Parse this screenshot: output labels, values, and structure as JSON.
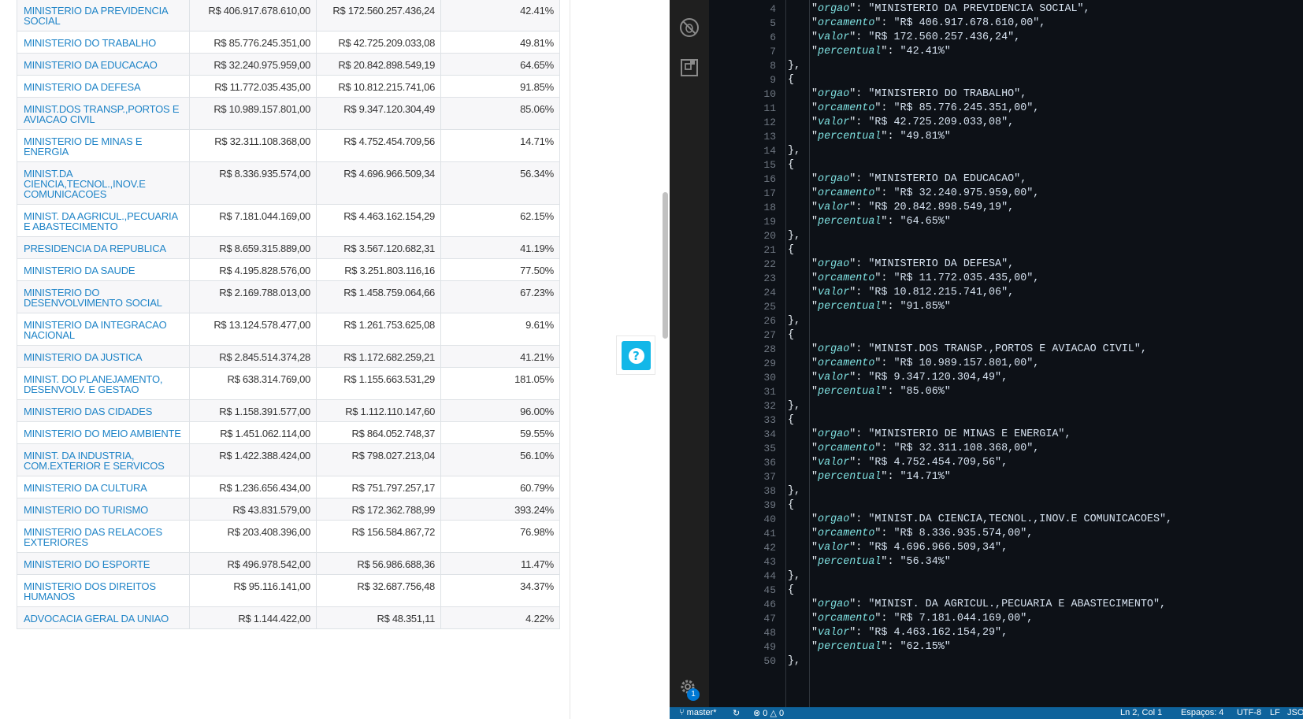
{
  "table": {
    "rows": [
      {
        "orgao": "MINISTERIO DA PREVIDENCIA SOCIAL",
        "orcamento": "R$ 406.917.678.610,00",
        "valor": "R$ 172.560.257.436,24",
        "percentual": "42.41%"
      },
      {
        "orgao": "MINISTERIO DO TRABALHO",
        "orcamento": "R$ 85.776.245.351,00",
        "valor": "R$ 42.725.209.033,08",
        "percentual": "49.81%"
      },
      {
        "orgao": "MINISTERIO DA EDUCACAO",
        "orcamento": "R$ 32.240.975.959,00",
        "valor": "R$ 20.842.898.549,19",
        "percentual": "64.65%"
      },
      {
        "orgao": "MINISTERIO DA DEFESA",
        "orcamento": "R$ 11.772.035.435,00",
        "valor": "R$ 10.812.215.741,06",
        "percentual": "91.85%"
      },
      {
        "orgao": "MINIST.DOS TRANSP.,PORTOS E AVIACAO CIVIL",
        "orcamento": "R$ 10.989.157.801,00",
        "valor": "R$ 9.347.120.304,49",
        "percentual": "85.06%"
      },
      {
        "orgao": "MINISTERIO DE MINAS E ENERGIA",
        "orcamento": "R$ 32.311.108.368,00",
        "valor": "R$ 4.752.454.709,56",
        "percentual": "14.71%"
      },
      {
        "orgao": "MINIST.DA CIENCIA,TECNOL.,INOV.E COMUNICACOES",
        "orcamento": "R$ 8.336.935.574,00",
        "valor": "R$ 4.696.966.509,34",
        "percentual": "56.34%"
      },
      {
        "orgao": "MINIST. DA AGRICUL.,PECUARIA E ABASTECIMENTO",
        "orcamento": "R$ 7.181.044.169,00",
        "valor": "R$ 4.463.162.154,29",
        "percentual": "62.15%"
      },
      {
        "orgao": "PRESIDENCIA DA REPUBLICA",
        "orcamento": "R$ 8.659.315.889,00",
        "valor": "R$ 3.567.120.682,31",
        "percentual": "41.19%"
      },
      {
        "orgao": "MINISTERIO DA SAUDE",
        "orcamento": "R$ 4.195.828.576,00",
        "valor": "R$ 3.251.803.116,16",
        "percentual": "77.50%"
      },
      {
        "orgao": "MINISTERIO DO DESENVOLVIMENTO SOCIAL",
        "orcamento": "R$ 2.169.788.013,00",
        "valor": "R$ 1.458.759.064,66",
        "percentual": "67.23%"
      },
      {
        "orgao": "MINISTERIO DA INTEGRACAO NACIONAL",
        "orcamento": "R$ 13.124.578.477,00",
        "valor": "R$ 1.261.753.625,08",
        "percentual": "9.61%"
      },
      {
        "orgao": "MINISTERIO DA JUSTICA",
        "orcamento": "R$ 2.845.514.374,28",
        "valor": "R$ 1.172.682.259,21",
        "percentual": "41.21%"
      },
      {
        "orgao": "MINIST. DO PLANEJAMENTO, DESENVOLV. E GESTAO",
        "orcamento": "R$ 638.314.769,00",
        "valor": "R$ 1.155.663.531,29",
        "percentual": "181.05%"
      },
      {
        "orgao": "MINISTERIO DAS CIDADES",
        "orcamento": "R$ 1.158.391.577,00",
        "valor": "R$ 1.112.110.147,60",
        "percentual": "96.00%"
      },
      {
        "orgao": "MINISTERIO DO MEIO AMBIENTE",
        "orcamento": "R$ 1.451.062.114,00",
        "valor": "R$ 864.052.748,37",
        "percentual": "59.55%"
      },
      {
        "orgao": "MINIST. DA INDUSTRIA, COM.EXTERIOR E SERVICOS",
        "orcamento": "R$ 1.422.388.424,00",
        "valor": "R$ 798.027.213,04",
        "percentual": "56.10%"
      },
      {
        "orgao": "MINISTERIO DA CULTURA",
        "orcamento": "R$ 1.236.656.434,00",
        "valor": "R$ 751.797.257,17",
        "percentual": "60.79%"
      },
      {
        "orgao": "MINISTERIO DO TURISMO",
        "orcamento": "R$ 43.831.579,00",
        "valor": "R$ 172.362.788,99",
        "percentual": "393.24%"
      },
      {
        "orgao": "MINISTERIO DAS RELACOES EXTERIORES",
        "orcamento": "R$ 203.408.396,00",
        "valor": "R$ 156.584.867,72",
        "percentual": "76.98%"
      },
      {
        "orgao": "MINISTERIO DO ESPORTE",
        "orcamento": "R$ 496.978.542,00",
        "valor": "R$ 56.986.688,36",
        "percentual": "11.47%"
      },
      {
        "orgao": "MINISTERIO DOS DIREITOS HUMANOS",
        "orcamento": "R$ 95.116.141,00",
        "valor": "R$ 32.687.756,48",
        "percentual": "34.37%"
      },
      {
        "orgao": "ADVOCACIA GERAL DA UNIAO",
        "orcamento": "R$ 1.144.422,00",
        "valor": "R$ 48.351,11",
        "percentual": "4.22%"
      }
    ]
  },
  "help_button": {
    "label": "?"
  },
  "editor": {
    "json_keys": {
      "orgao": "orgao",
      "orcamento": "orcamento",
      "valor": "valor",
      "percentual": "percentual"
    },
    "lines": [
      {
        "n": "4",
        "type": "kv",
        "key": "orgao",
        "val": "\"MINISTERIO DA PREVIDENCIA SOCIAL\","
      },
      {
        "n": "5",
        "type": "kv",
        "key": "orcamento",
        "val": "\"R$ 406.917.678.610,00\","
      },
      {
        "n": "6",
        "type": "kv",
        "key": "valor",
        "val": "\"R$ 172.560.257.436,24\","
      },
      {
        "n": "7",
        "type": "kv",
        "key": "percentual",
        "val": "\"42.41%\""
      },
      {
        "n": "8",
        "type": "close",
        "text": "},"
      },
      {
        "n": "9",
        "type": "open",
        "text": "{"
      },
      {
        "n": "10",
        "type": "kv",
        "key": "orgao",
        "val": "\"MINISTERIO DO TRABALHO\","
      },
      {
        "n": "11",
        "type": "kv",
        "key": "orcamento",
        "val": "\"R$ 85.776.245.351,00\","
      },
      {
        "n": "12",
        "type": "kv",
        "key": "valor",
        "val": "\"R$ 42.725.209.033,08\","
      },
      {
        "n": "13",
        "type": "kv",
        "key": "percentual",
        "val": "\"49.81%\""
      },
      {
        "n": "14",
        "type": "close",
        "text": "},"
      },
      {
        "n": "15",
        "type": "open",
        "text": "{"
      },
      {
        "n": "16",
        "type": "kv",
        "key": "orgao",
        "val": "\"MINISTERIO DA EDUCACAO\","
      },
      {
        "n": "17",
        "type": "kv",
        "key": "orcamento",
        "val": "\"R$ 32.240.975.959,00\","
      },
      {
        "n": "18",
        "type": "kv",
        "key": "valor",
        "val": "\"R$ 20.842.898.549,19\","
      },
      {
        "n": "19",
        "type": "kv",
        "key": "percentual",
        "val": "\"64.65%\""
      },
      {
        "n": "20",
        "type": "close",
        "text": "},"
      },
      {
        "n": "21",
        "type": "open",
        "text": "{"
      },
      {
        "n": "22",
        "type": "kv",
        "key": "orgao",
        "val": "\"MINISTERIO DA DEFESA\","
      },
      {
        "n": "23",
        "type": "kv",
        "key": "orcamento",
        "val": "\"R$ 11.772.035.435,00\","
      },
      {
        "n": "24",
        "type": "kv",
        "key": "valor",
        "val": "\"R$ 10.812.215.741,06\","
      },
      {
        "n": "25",
        "type": "kv",
        "key": "percentual",
        "val": "\"91.85%\""
      },
      {
        "n": "26",
        "type": "close",
        "text": "},"
      },
      {
        "n": "27",
        "type": "open",
        "text": "{"
      },
      {
        "n": "28",
        "type": "kv",
        "key": "orgao",
        "val": "\"MINIST.DOS TRANSP.,PORTOS E AVIACAO CIVIL\","
      },
      {
        "n": "29",
        "type": "kv",
        "key": "orcamento",
        "val": "\"R$ 10.989.157.801,00\","
      },
      {
        "n": "30",
        "type": "kv",
        "key": "valor",
        "val": "\"R$ 9.347.120.304,49\","
      },
      {
        "n": "31",
        "type": "kv",
        "key": "percentual",
        "val": "\"85.06%\""
      },
      {
        "n": "32",
        "type": "close",
        "text": "},"
      },
      {
        "n": "33",
        "type": "open",
        "text": "{"
      },
      {
        "n": "34",
        "type": "kv",
        "key": "orgao",
        "val": "\"MINISTERIO DE MINAS E ENERGIA\","
      },
      {
        "n": "35",
        "type": "kv",
        "key": "orcamento",
        "val": "\"R$ 32.311.108.368,00\","
      },
      {
        "n": "36",
        "type": "kv",
        "key": "valor",
        "val": "\"R$ 4.752.454.709,56\","
      },
      {
        "n": "37",
        "type": "kv",
        "key": "percentual",
        "val": "\"14.71%\""
      },
      {
        "n": "38",
        "type": "close",
        "text": "},"
      },
      {
        "n": "39",
        "type": "open",
        "text": "{"
      },
      {
        "n": "40",
        "type": "kv",
        "key": "orgao",
        "val": "\"MINIST.DA CIENCIA,TECNOL.,INOV.E COMUNICACOES\","
      },
      {
        "n": "41",
        "type": "kv",
        "key": "orcamento",
        "val": "\"R$ 8.336.935.574,00\","
      },
      {
        "n": "42",
        "type": "kv",
        "key": "valor",
        "val": "\"R$ 4.696.966.509,34\","
      },
      {
        "n": "43",
        "type": "kv",
        "key": "percentual",
        "val": "\"56.34%\""
      },
      {
        "n": "44",
        "type": "close",
        "text": "},"
      },
      {
        "n": "45",
        "type": "open",
        "text": "{"
      },
      {
        "n": "46",
        "type": "kv",
        "key": "orgao",
        "val": "\"MINIST. DA AGRICUL.,PECUARIA E ABASTECIMENTO\","
      },
      {
        "n": "47",
        "type": "kv",
        "key": "orcamento",
        "val": "\"R$ 7.181.044.169,00\","
      },
      {
        "n": "48",
        "type": "kv",
        "key": "valor",
        "val": "\"R$ 4.463.162.154,29\","
      },
      {
        "n": "49",
        "type": "kv",
        "key": "percentual",
        "val": "\"62.15%\""
      },
      {
        "n": "50",
        "type": "close",
        "text": "},"
      }
    ]
  },
  "statusbar": {
    "branch": "master*",
    "errors": "0",
    "warnings": "0",
    "cursor": "Ln 2, Col 1",
    "indent": "Espaços: 4",
    "encoding": "UTF-8",
    "eol": "LF",
    "language": "JSON"
  },
  "activity": {
    "badge": "1"
  },
  "colors": {
    "link": "#1f84c7",
    "help": "#12b7e8",
    "editor_bg": "#0d1117",
    "statusbar": "#0e639c",
    "json_key": "#7ee0e0"
  }
}
